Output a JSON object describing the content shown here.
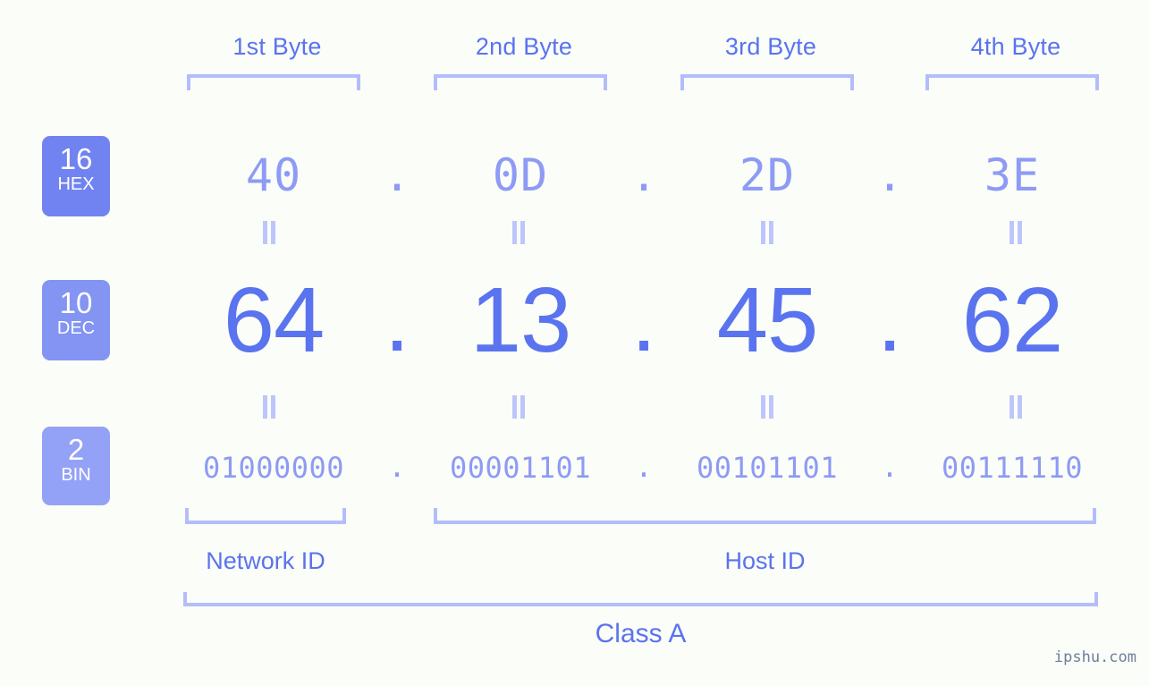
{
  "bytes": [
    {
      "header": "1st Byte",
      "hex": "40",
      "dec": "64",
      "bin": "01000000"
    },
    {
      "header": "2nd Byte",
      "hex": "0D",
      "dec": "13",
      "bin": "00001101"
    },
    {
      "header": "3rd Byte",
      "hex": "2D",
      "dec": "45",
      "bin": "00101101"
    },
    {
      "header": "4th Byte",
      "hex": "3E",
      "dec": "62",
      "bin": "00111110"
    }
  ],
  "separator": ".",
  "bases": [
    {
      "number": "16",
      "abbr": "HEX"
    },
    {
      "number": "10",
      "abbr": "DEC"
    },
    {
      "number": "2",
      "abbr": "BIN"
    }
  ],
  "equality_symbol": "=",
  "segments": {
    "network_id": "Network ID",
    "host_id": "Host ID"
  },
  "class_label": "Class A",
  "watermark": "ipshu.com",
  "colors": {
    "background": "#fbfdf8",
    "primary_text": "#5a73ef",
    "secondary_text": "#8d9bf5",
    "bracket": "#b3bdfb",
    "badge_hex": "#7183f0",
    "badge_dec": "#8394f3",
    "badge_bin": "#93a2f7",
    "watermark": "#6d7f9c"
  }
}
